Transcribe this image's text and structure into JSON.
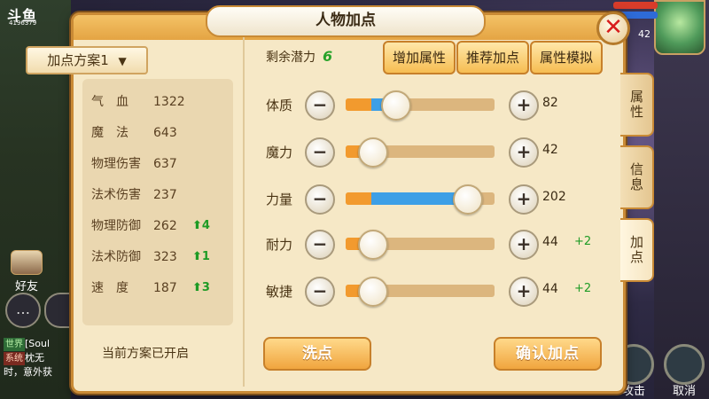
{
  "background": {
    "brand": "斗鱼",
    "brand_sub": "4196379",
    "friend_label": "好友",
    "chat_lines": [
      {
        "tag": "世界",
        "text": "[Soul"
      },
      {
        "tag": "系统",
        "text": "枕无"
      },
      {
        "tag": "",
        "text": "时，意外获"
      }
    ],
    "level": "42",
    "bottom_actions": [
      "攻击",
      "取消"
    ]
  },
  "dialog": {
    "title": "人物加点",
    "close_icon": "close-x-icon",
    "scheme_button": "加点方案1",
    "scheme_status": "当前方案已开启",
    "potential_label": "剩余潜力",
    "potential_value": "6",
    "top_buttons": [
      "增加属性",
      "推荐加点",
      "属性模拟"
    ],
    "stats": [
      {
        "label": "气　血",
        "value": "1322",
        "up": ""
      },
      {
        "label": "魔　法",
        "value": "643",
        "up": ""
      },
      {
        "label": "物理伤害",
        "value": "637",
        "up": ""
      },
      {
        "label": "法术伤害",
        "value": "237",
        "up": ""
      },
      {
        "label": "物理防御",
        "value": "262",
        "up": "4"
      },
      {
        "label": "法术防御",
        "value": "323",
        "up": "1"
      },
      {
        "label": "速　度",
        "value": "187",
        "up": "3"
      }
    ],
    "attributes": [
      {
        "label": "体质",
        "value": "82",
        "bonus": "",
        "base_fraction": 0.17,
        "slider_fraction": 0.33
      },
      {
        "label": "魔力",
        "value": "42",
        "bonus": "",
        "base_fraction": 0.17,
        "slider_fraction": 0.17
      },
      {
        "label": "力量",
        "value": "202",
        "bonus": "",
        "base_fraction": 0.17,
        "slider_fraction": 0.81
      },
      {
        "label": "耐力",
        "value": "44",
        "bonus": "+2",
        "base_fraction": 0.17,
        "slider_fraction": 0.17
      },
      {
        "label": "敏捷",
        "value": "44",
        "bonus": "+2",
        "base_fraction": 0.17,
        "slider_fraction": 0.17
      }
    ],
    "wash_button": "洗点",
    "confirm_button": "确认加点",
    "side_tabs": [
      "属性",
      "信息",
      "加点"
    ],
    "active_tab": "加点",
    "colors": {
      "frame": "#c98a35",
      "parchment": "#f6e8c6",
      "fill_orange": "#f29a2e",
      "fill_blue": "#3d9fe6",
      "bonus_green": "#1e9b25"
    }
  }
}
